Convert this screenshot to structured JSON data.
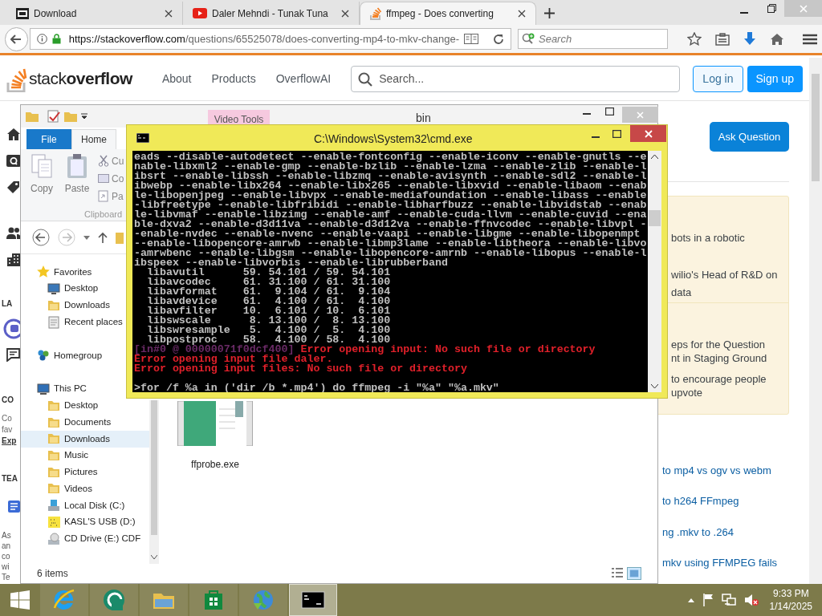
{
  "browser": {
    "tabs": [
      {
        "title": "Download",
        "kind": "sevenzip",
        "selected": false
      },
      {
        "title": "Daler Mehndi - Tunak Tuna",
        "kind": "video",
        "selected": false
      },
      {
        "title": "ffmpeg - Does converting",
        "kind": "stack",
        "selected": true
      }
    ],
    "url_host": "https://stackoverflow.com",
    "url_path": "/questions/65525078/does-converting-mp4-to-mkv-change-",
    "search_placeholder": "Search"
  },
  "site": {
    "logo_light": "stack",
    "logo_bold": "overflow",
    "nav": [
      "About",
      "Products",
      "OverflowAI"
    ],
    "search_placeholder": "Search...",
    "login": "Log in",
    "signup": "Sign up",
    "ask": "Ask Question",
    "left_texts": [
      "LA",
      "CO",
      "Co",
      "fav",
      "Exp",
      "TEA",
      "As",
      "an",
      "co",
      "wi",
      "Te"
    ],
    "card_sections": [
      [
        "bots in a robotic",
        "wilio's Head of R&D on",
        "data"
      ],
      [
        "eps for the Question",
        "nt in Staging Ground",
        "to encourage people",
        "upvote"
      ]
    ],
    "related": [
      "to mp4 vs ogv vs webm",
      "to h264 FFmpeg",
      "ng .mkv to .264",
      "mkv using FFMPEG fails"
    ]
  },
  "explorer": {
    "title": "bin",
    "context_tab": "Video Tools",
    "ribbon_tabs": [
      {
        "label": "File",
        "kind": "file",
        "selected": false
      },
      {
        "label": "Home",
        "kind": "tab",
        "selected": true
      }
    ],
    "clipboard": {
      "copy": "Copy",
      "paste": "Paste",
      "small": [
        "Cu",
        "Co",
        "Pa"
      ],
      "group": "Clipboard"
    },
    "nav": [
      {
        "label": "Favorites",
        "kind": "star",
        "selected": false,
        "children": [
          {
            "label": "Desktop",
            "kind": "desktop",
            "selected": false
          },
          {
            "label": "Downloads",
            "kind": "folder",
            "selected": false
          },
          {
            "label": "Recent places",
            "kind": "recent",
            "selected": false
          }
        ]
      },
      {
        "label": "Homegroup",
        "kind": "homegroup",
        "selected": false
      },
      {
        "label": "This PC",
        "kind": "pc",
        "selected": false,
        "children": [
          {
            "label": "Desktop",
            "kind": "folder",
            "selected": false
          },
          {
            "label": "Documents",
            "kind": "folder",
            "selected": false
          },
          {
            "label": "Downloads",
            "kind": "folder",
            "selected": true
          },
          {
            "label": "Music",
            "kind": "folder",
            "selected": false
          },
          {
            "label": "Pictures",
            "kind": "folder",
            "selected": false
          },
          {
            "label": "Videos",
            "kind": "folder",
            "selected": false
          },
          {
            "label": "Local Disk (C:)",
            "kind": "disk",
            "selected": false
          },
          {
            "label": "KASL'S USB (D:)",
            "kind": "usb",
            "selected": false
          },
          {
            "label": "CD Drive (E:) CDF",
            "kind": "cd",
            "selected": false
          }
        ]
      }
    ],
    "file": "ffprobe.exe",
    "status": "6 items"
  },
  "cmd": {
    "title": "C:\\Windows\\System32\\cmd.exe",
    "lines": [
      {
        "kind": "out",
        "text": "eads --disable-autodetect --enable-fontconfig --enable-iconv --enable-gnutls --e"
      },
      {
        "kind": "out",
        "text": "nable-libxml2 --enable-gmp --enable-bzlib --enable-lzma --enable-zlib --enable-l"
      },
      {
        "kind": "out",
        "text": "ibsrt --enable-libssh --enable-libzmq --enable-avisynth --enable-sdl2 --enable-l"
      },
      {
        "kind": "out",
        "text": "ibwebp --enable-libx264 --enable-libx265 --enable-libxvid --enable-libaom --enab"
      },
      {
        "kind": "out",
        "text": "le-libopenjpeg --enable-libvpx --enable-mediafoundation --enable-libass --enable"
      },
      {
        "kind": "out",
        "text": "-libfreetype --enable-libfribidi --enable-libharfbuzz --enable-libvidstab --enab"
      },
      {
        "kind": "out",
        "text": "le-libvmaf --enable-libzimg --enable-amf --enable-cuda-llvm --enable-cuvid --ena"
      },
      {
        "kind": "out",
        "text": "ble-dxva2 --enable-d3d11va --enable-d3d12va --enable-ffnvcodec --enable-libvpl -"
      },
      {
        "kind": "out",
        "text": "-enable-nvdec --enable-nvenc --enable-vaapi --enable-libgme --enable-libopenmpt"
      },
      {
        "kind": "out",
        "text": "--enable-libopencore-amrwb --enable-libmp3lame --enable-libtheora --enable-libvo"
      },
      {
        "kind": "out",
        "text": "-amrwbenc --enable-libgsm --enable-libopencore-amrnb --enable-libopus --enable-l"
      },
      {
        "kind": "out",
        "text": "ibspeex --enable-libvorbis --enable-librubberband"
      },
      {
        "kind": "out",
        "text": "  libavutil      59. 54.101 / 59. 54.101"
      },
      {
        "kind": "out",
        "text": "  libavcodec     61. 31.100 / 61. 31.100"
      },
      {
        "kind": "out",
        "text": "  libavformat    61.  9.104 / 61.  9.104"
      },
      {
        "kind": "out",
        "text": "  libavdevice    61.  4.100 / 61.  4.100"
      },
      {
        "kind": "out",
        "text": "  libavfilter    10.  6.101 / 10.  6.101"
      },
      {
        "kind": "out",
        "text": "  libswscale      8. 13.100 /  8. 13.100"
      },
      {
        "kind": "out",
        "text": "  libswresample   5.  4.100 /  5.  4.100"
      },
      {
        "kind": "out",
        "text": "  libpostproc    58.  4.100 / 58.  4.100"
      },
      {
        "kind": "error",
        "prefix": "[in#0 @ 00000071f0dcf400]",
        "text": " Error opening input: No such file or directory"
      },
      {
        "kind": "error",
        "text": "Error opening input file daler."
      },
      {
        "kind": "error",
        "text": "Error opening input files: No such file or directory"
      },
      {
        "kind": "blank"
      },
      {
        "kind": "out",
        "text": ">for /f %a in ('dir /b *.mp4') do ffmpeg -i \"%a\" \"%a.mkv\""
      }
    ]
  },
  "taskbar": {
    "apps": [
      {
        "kind": "ie",
        "active": false
      },
      {
        "kind": "ring",
        "active": false
      },
      {
        "kind": "explorer",
        "active": false
      },
      {
        "kind": "store",
        "active": false
      },
      {
        "kind": "globe",
        "active": false
      },
      {
        "kind": "cmd",
        "active": true
      }
    ],
    "time": "9:33 PM",
    "date": "1/14/2025"
  }
}
